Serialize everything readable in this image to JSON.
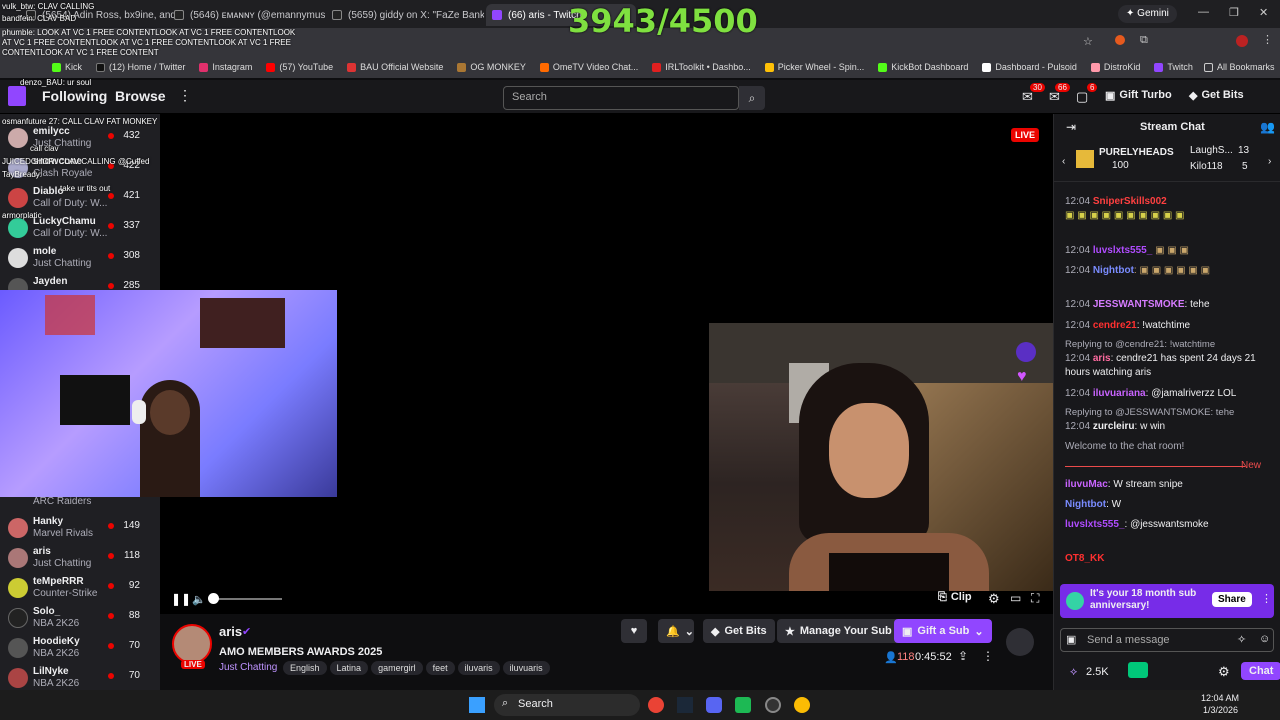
{
  "browser": {
    "tabs": [
      {
        "label": "(5654) Adin Ross, bx9ine, and",
        "color": "#444"
      },
      {
        "label": "(5646) ᴇᴍᴀɴɴʏ (@emannymusic",
        "color": "#444"
      },
      {
        "label": "(5659) giddy on X: \"FaZe Banks",
        "color": "#444"
      },
      {
        "label": "(66) aris - Twitch",
        "color": "#9146ff"
      }
    ],
    "gemini_label": "Gemini",
    "all_bookmarks": "All Bookmarks",
    "bookmarks": [
      {
        "label": "Kick",
        "color": "#53fc18"
      },
      {
        "label": "(12) Home / Twitter",
        "color": "#111"
      },
      {
        "label": "Instagram",
        "color": "#e1306c"
      },
      {
        "label": "(57) YouTube",
        "color": "#ff0000"
      },
      {
        "label": "BAU Official Website",
        "color": "#d33"
      },
      {
        "label": "OG MONKEY",
        "color": "#aa7733"
      },
      {
        "label": "OmeTV Video Chat...",
        "color": "#ff6a00"
      },
      {
        "label": "IRLToolkit • Dashbo...",
        "color": "#e02020"
      },
      {
        "label": "Picker Wheel - Spin...",
        "color": "#ffc107"
      },
      {
        "label": "KickBot Dashboard",
        "color": "#53fc18"
      },
      {
        "label": "Dashboard - Pulsoid",
        "color": "#fff"
      },
      {
        "label": "DistroKid",
        "color": "#f9a"
      },
      {
        "label": "Twitch",
        "color": "#9146ff"
      }
    ]
  },
  "overlay": {
    "counter": "3943/4500",
    "chat_lines": [
      "vulk_btw: CLAV CALLING",
      "bandfein: CLAV BAD",
      "phumble: LOOK AT VC 1 FREE CONTENTLOOK AT VC 1 FREE CONTENTLOOK AT VC 1 FREE CONTENTLOOK AT VC 1 FREE CONTENTLOOK AT VC 1 FREE CONTENTLOOK AT VC 1 FREE CONTENT",
      "denzo_BAU: ur soul",
      "osmanfuture 27: CALL CLAV FAT MONKEY",
      "call clav",
      "JUICEDCHOR: CLAV CALLING @Cuffed",
      "TayBready:",
      "take ur tits out",
      "armorplatic"
    ]
  },
  "nav": {
    "following": "Following",
    "browse": "Browse",
    "search_placeholder": "Search",
    "badge_inbox": "30",
    "badge_whispers": "66",
    "badge_notif": "6",
    "gift_turbo": "Gift Turbo",
    "get_bits": "Get Bits"
  },
  "sidebar": {
    "channels_top": [
      {
        "name": "emilycc",
        "game": "Just Chatting",
        "count": "432",
        "color": "#caa"
      },
      {
        "name": "snowcone",
        "game": "Clash Royale",
        "count": "422",
        "color": "#aac"
      },
      {
        "name": "Diablo",
        "game": "Call of Duty: W...",
        "count": "421",
        "color": "#c44"
      },
      {
        "name": "LuckyChamu",
        "game": "Call of Duty: W...",
        "count": "337",
        "color": "#3c9"
      },
      {
        "name": "mole",
        "game": "Just Chatting",
        "count": "308",
        "color": "#ddd"
      },
      {
        "name": "Jayden",
        "game": "",
        "count": "285",
        "color": "#555"
      }
    ],
    "channels_bottom": [
      {
        "name": "",
        "game": "ARC Raiders",
        "count": "",
        "color": "#884"
      },
      {
        "name": "Hanky",
        "game": "Marvel Rivals",
        "count": "149",
        "color": "#c66"
      },
      {
        "name": "aris",
        "game": "Just Chatting",
        "count": "118",
        "color": "#a77"
      },
      {
        "name": "teMpeRRR",
        "game": "Counter-Strike",
        "count": "92",
        "color": "#cc3"
      },
      {
        "name": "Solo_",
        "game": "NBA 2K26",
        "count": "88",
        "color": "#222"
      },
      {
        "name": "HoodieKy",
        "game": "NBA 2K26",
        "count": "70",
        "color": "#555"
      },
      {
        "name": "LilNyke",
        "game": "NBA 2K26",
        "count": "70",
        "color": "#a44"
      }
    ]
  },
  "player": {
    "live_label": "LIVE",
    "clip_label": "Clip",
    "progress": 0.0
  },
  "stream": {
    "streamer": "aris",
    "title": "AMO MEMBERS AWARDS 2025",
    "category": "Just Chatting",
    "tags": [
      "English",
      "Latina",
      "gamergirl",
      "feet",
      "iluvaris",
      "iluvuaris"
    ],
    "viewers": "118",
    "uptime": "0:45:52",
    "live_badge": "LIVE",
    "get_bits": "Get Bits",
    "manage_sub": "Manage Your Sub",
    "gift_sub": "Gift a Sub"
  },
  "chat": {
    "header": "Stream Chat",
    "gifter_top": "PURELYHEADS",
    "gifter_top_count": "100",
    "gifter_2": "LaughS...",
    "gifter_2_count": "13",
    "gifter_3": "Kilo118",
    "gifter_3_count": "5",
    "messages": [
      {
        "time": "12:04",
        "user": "SniperSkills002",
        "color": "#ff4040",
        "text": ""
      },
      {
        "time": "12:04",
        "user": "luvslxts555_",
        "color": "#b04cff",
        "text": ""
      },
      {
        "time": "12:04",
        "user": "Nightbot",
        "color": "#7a8cff",
        "text": ""
      },
      {
        "time": "12:04",
        "user": "JESSWANTSMOKE",
        "color": "#d67cff",
        "text": "tehe"
      },
      {
        "time": "12:04",
        "user": "cendre21",
        "color": "#ff3030",
        "text": "!watchtime"
      },
      {
        "time": "12:04",
        "user": "aris",
        "color": "#ff6ba0",
        "text": "cendre21 has spent 24 days 21 hours watching aris"
      },
      {
        "time": "12:04",
        "user": "iluvuariana",
        "color": "#c964ff",
        "text": "@jamalriverzz LOL"
      },
      {
        "time": "12:04",
        "user": "zurcleiru",
        "color": "#fff",
        "text": "w win"
      }
    ],
    "reply1": "Replying to @cendre21: !watchtime",
    "reply2": "Replying to @JESSWANTSMOKE: tehe",
    "welcome": "Welcome to the chat room!",
    "new_label": "New",
    "new_messages": [
      {
        "user": "iluvuMac",
        "color": "#c964ff",
        "text": "W stream snipe"
      },
      {
        "user": "Nightbot",
        "color": "#7a8cff",
        "text": "W"
      },
      {
        "user": "luvslxts555_",
        "color": "#b04cff",
        "text": "@jesswantsmoke"
      },
      {
        "user": "OT8_KK",
        "color": "#ff3030",
        "text": ""
      }
    ],
    "anniversary": "It's your 18 month sub anniversary!",
    "share": "Share",
    "send_placeholder": "Send a message",
    "points": "2.5K",
    "chat_button": "Chat"
  },
  "taskbar": {
    "search": "Search",
    "time": "12:04 AM",
    "date": "1/3/2026"
  }
}
